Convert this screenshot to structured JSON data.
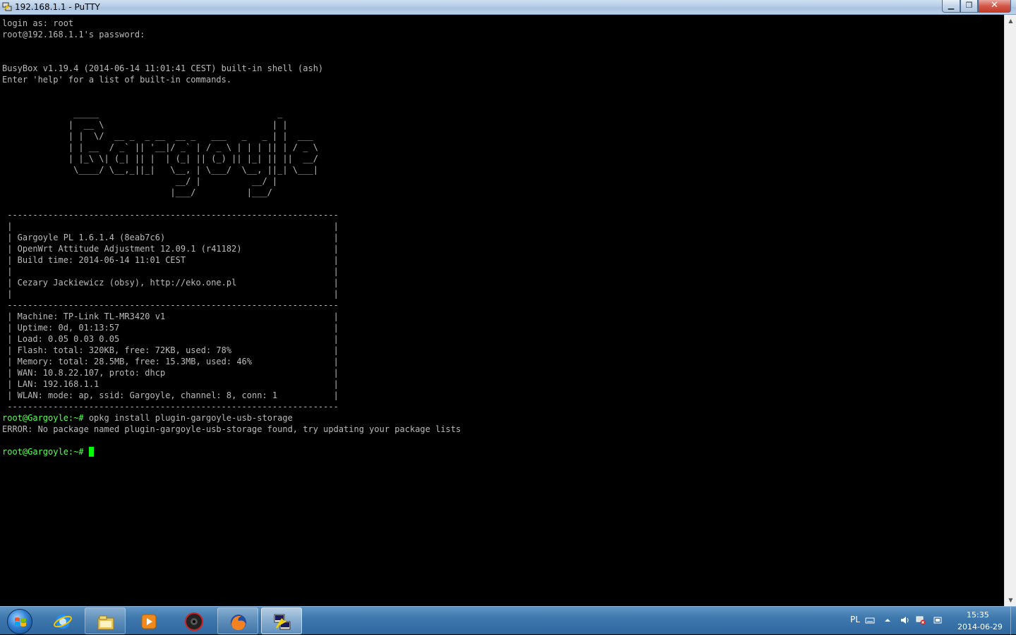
{
  "window": {
    "title": "192.168.1.1 - PuTTY",
    "buttons": {
      "minimize": "▁",
      "maximize": "❐",
      "close": "✕"
    }
  },
  "terminal": {
    "lines": [
      "login as: root",
      "root@192.168.1.1's password:",
      "",
      "",
      "BusyBox v1.19.4 (2014-06-14 11:01:41 CEST) built-in shell (ash)",
      "Enter 'help' for a list of built-in commands.",
      "",
      "",
      "              _____                                   _",
      "             |  __ \\                                 | |",
      "             | |  \\/  __ _  _ __  __ _   ___   _   _ | |  ___",
      "             | | __  / _` || '__|/ _` | / _ \\ | | | || | / _ \\",
      "             | |_\\ \\| (_| || |  | (_| || (_) || |_| || ||  __/",
      "              \\____/ \\__,_||_|   \\__, | \\___/  \\__, ||_| \\___|",
      "                                  __/ |          __/ |",
      "                                 |___/          |___/",
      "",
      " -----------------------------------------------------------------",
      " |                                                               |",
      " | Gargoyle PL 1.6.1.4 (8eab7c6)                                 |",
      " | OpenWrt Attitude Adjustment 12.09.1 (r41182)                  |",
      " | Build time: 2014-06-14 11:01 CEST                             |",
      " |                                                               |",
      " | Cezary Jackiewicz (obsy), http://eko.one.pl                   |",
      " |                                                               |",
      " -----------------------------------------------------------------",
      " | Machine: TP-Link TL-MR3420 v1                                 |",
      " | Uptime: 0d, 01:13:57                                          |",
      " | Load: 0.05 0.03 0.05                                          |",
      " | Flash: total: 320KB, free: 72KB, used: 78%                    |",
      " | Memory: total: 28.5MB, free: 15.3MB, used: 46%                |",
      " | WAN: 10.8.22.107, proto: dhcp                                 |",
      " | LAN: 192.168.1.1                                              |",
      " | WLAN: mode: ap, ssid: Gargoyle, channel: 8, conn: 1           |",
      " -----------------------------------------------------------------"
    ],
    "prompt": "root@Gargoyle:~# ",
    "command": "opkg install plugin-gargoyle-usb-storage",
    "error": "ERROR: No package named plugin-gargoyle-usb-storage found, try updating your package lists",
    "prompt2": "root@Gargoyle:~# "
  },
  "taskbar": {
    "items": [
      {
        "name": "internet-explorer",
        "icon": "ie-icon"
      },
      {
        "name": "windows-explorer",
        "icon": "folder-icon"
      },
      {
        "name": "media-player",
        "icon": "media-player-icon"
      },
      {
        "name": "webcam-app",
        "icon": "webcam-icon"
      },
      {
        "name": "firefox",
        "icon": "firefox-icon"
      },
      {
        "name": "putty",
        "icon": "putty-icon",
        "active": true
      }
    ],
    "tray": {
      "language": "PL",
      "time": "15:35",
      "date": "2014-06-29"
    }
  },
  "colors": {
    "terminal_bg": "#000000",
    "terminal_fg": "#bbbbbb",
    "prompt_green": "#55ff55",
    "cursor": "#00ff00",
    "taskbar": "#3e78ad"
  }
}
